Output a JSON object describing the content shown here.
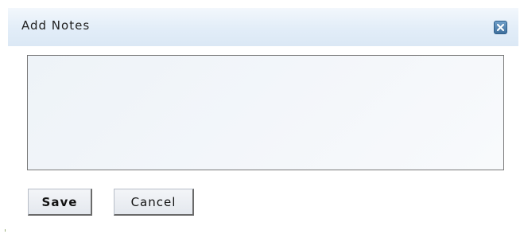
{
  "dialog": {
    "title": "Add Notes",
    "close_icon": "close-x-icon",
    "notes": {
      "value": "",
      "placeholder": ""
    },
    "buttons": {
      "save_label": "Save",
      "cancel_label": "Cancel"
    }
  },
  "colors": {
    "titlebar_bg": "#e2edf8",
    "close_button": "#4a7aa8",
    "textarea_bg": "#f1f5f9",
    "button_bg": "#e8ebf0"
  }
}
